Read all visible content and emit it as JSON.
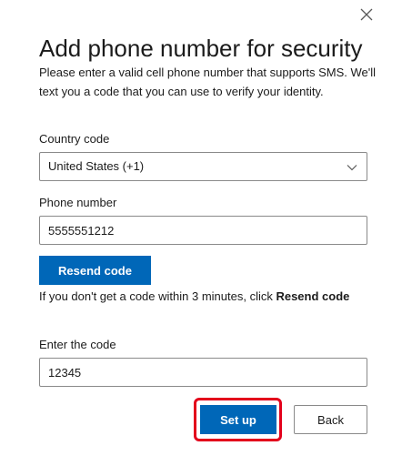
{
  "dialog": {
    "title": "Add phone number for security",
    "description": "Please enter a valid cell phone number that supports SMS. We'll text you a code that you can use to verify your identity.",
    "close_icon": "close-icon"
  },
  "country": {
    "label": "Country code",
    "value": "United States (+1)",
    "icon": "chevron-down-icon"
  },
  "phone": {
    "label": "Phone number",
    "value": "5555551212"
  },
  "resend": {
    "label": "Resend code"
  },
  "hint": {
    "text": "If you don't get a code within 3 minutes, click ",
    "bold": "Resend code"
  },
  "code": {
    "label": "Enter the code",
    "value": "12345"
  },
  "actions": {
    "setup_label": "Set up",
    "back_label": "Back",
    "highlight_color": "#e3001b"
  },
  "colors": {
    "primary": "#0067b8"
  }
}
